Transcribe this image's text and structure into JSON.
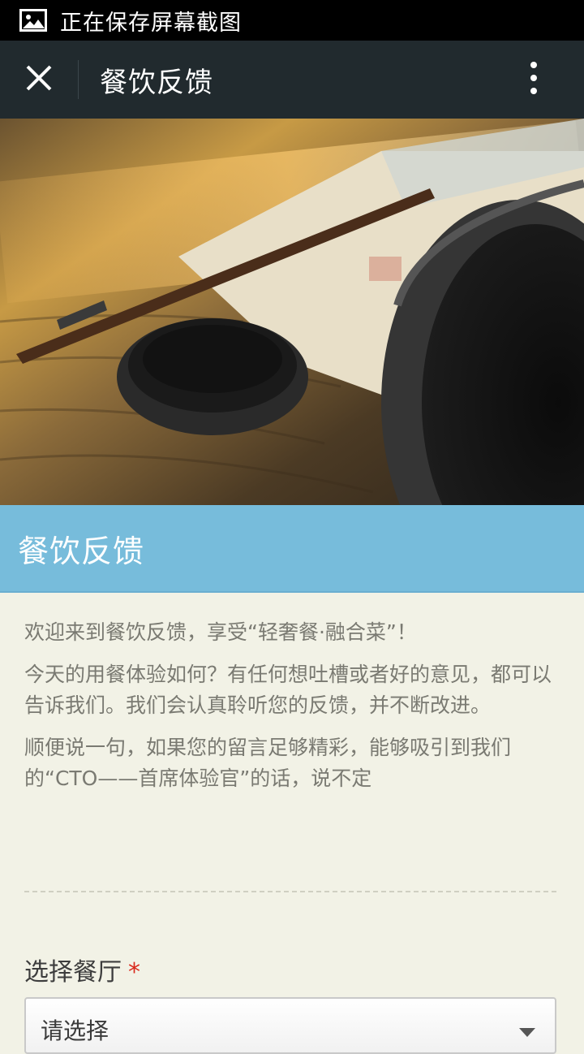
{
  "status_bar": {
    "text": "正在保存屏幕截图",
    "icon": "image-icon"
  },
  "app_bar": {
    "title": "餐饮反馈",
    "close_icon": "close-icon",
    "more_icon": "more-vert-icon"
  },
  "hero": {
    "image": "restaurant-tableware-photo"
  },
  "banner": {
    "title": "餐饮反馈"
  },
  "intro": {
    "p1": "欢迎来到餐饮反馈，享受“轻奢餐·融合菜”！",
    "p2": "今天的用餐体验如何？有任何想吐槽或者好的意见，都可以告诉我们。我们会认真聆听您的反馈，并不断改进。",
    "p3": "顺便说一句，如果您的留言足够精彩，能够吸引到我们的“CTO——首席体验官”的话，说不定"
  },
  "form": {
    "restaurant_label": "选择餐厅",
    "required_mark": "*",
    "select_value": "请选择"
  },
  "colors": {
    "app_bar": "#212a2e",
    "banner": "#77bcdb",
    "page_bg": "#f2f2e6",
    "required": "#d9291c"
  }
}
